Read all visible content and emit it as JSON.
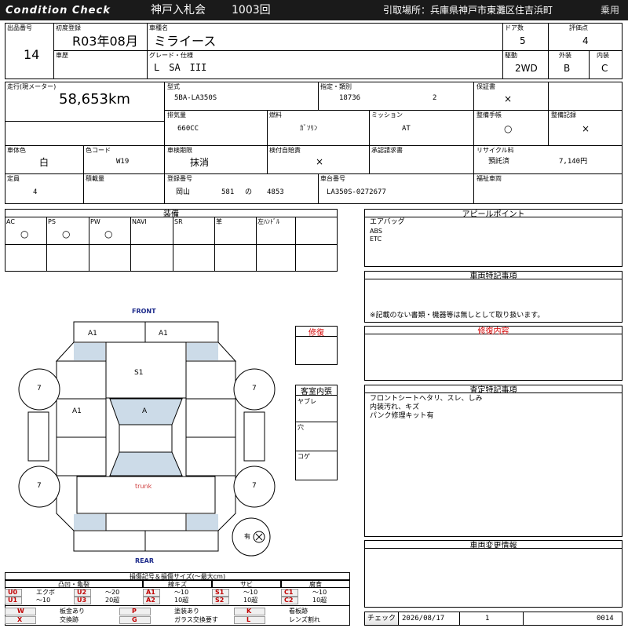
{
  "header": {
    "brand": "Condition Check",
    "auction": "神戸入札会",
    "session": "1003回",
    "location": "引取場所：兵庫県神戸市東灘区住吉浜町",
    "category": "乗用"
  },
  "top": {
    "lot_label": "出品番号",
    "lot": "14",
    "first_reg_label": "初度登録",
    "first_reg": "R03年08月",
    "name_label": "車種名",
    "name": "ミライース",
    "doors_label": "ドア数",
    "doors": "5",
    "score_label": "評価点",
    "score": "4",
    "history_label": "車歴",
    "grade_label": "グレード・仕様",
    "grade": "L　SA　III",
    "drive_label": "駆動",
    "drive": "2WD",
    "ext_label": "外装",
    "ext": "B",
    "int_label": "内装",
    "int": "C"
  },
  "spec": {
    "mileage_label": "走行(現メーター)",
    "mileage": "58,653km",
    "model_label": "型式",
    "model": "5BA-LA350S",
    "cat_label": "指定・類別",
    "cat_a": "18736",
    "cat_b": "2",
    "warranty_label": "保証書",
    "warranty": "×",
    "disp_label": "排気量",
    "disp": "660CC",
    "fuel_label": "燃料",
    "fuel": "ｶﾞｿﾘﾝ",
    "mission_label": "ミッション",
    "mission": "AT",
    "manual_label": "整備手帳",
    "manual": "○",
    "record_label": "整備記録",
    "record": "×",
    "color_label": "車体色",
    "color": "白",
    "color_code_label": "色コード",
    "color_code": "W19",
    "inspect_label": "車検期限",
    "inspect": "抹消",
    "insurance_label": "検付自賠責",
    "insurance": "×",
    "approve_label": "承認請求書",
    "recycle_label": "リサイクル料",
    "recycle_status": "預託済",
    "recycle_fee": "7,140円",
    "capacity_label": "定員",
    "capacity": "4",
    "load_label": "積載量",
    "reg_label": "登録番号",
    "reg_area": "岡山",
    "reg_class": "581",
    "reg_kana": "の",
    "reg_no": "4853",
    "chassis_label": "車台番号",
    "chassis": "LA350S-0272677",
    "welfare_label": "福祉車両"
  },
  "equipment": {
    "title": "装備",
    "items": [
      {
        "label": "AC",
        "mark": "○"
      },
      {
        "label": "PS",
        "mark": "○"
      },
      {
        "label": "PW",
        "mark": "○"
      },
      {
        "label": "NAVI",
        "mark": ""
      },
      {
        "label": "SR",
        "mark": ""
      },
      {
        "label": "革",
        "mark": ""
      },
      {
        "label": "左ﾊﾝﾄﾞﾙ",
        "mark": ""
      }
    ]
  },
  "appeal": {
    "title": "アピールポイント",
    "lines": [
      "エアバッグ",
      "ABS",
      "ETC"
    ]
  },
  "special": {
    "title": "車両特記事項",
    "note": "※記載のない書類・機器等は無しとして取り扱います。"
  },
  "repair_content": {
    "title": "修復内容"
  },
  "assess": {
    "title": "査定特記事項",
    "lines": [
      "フロントシートヘタリ、スレ、しみ",
      "内装汚れ、キズ",
      "パンク修理キット有"
    ]
  },
  "change": {
    "title": "車両変更情報"
  },
  "diagram": {
    "front": "FRONT",
    "rear": "REAR",
    "trunk": "trunk",
    "marks": {
      "fl": "A1",
      "fr": "A1",
      "roof": "S1",
      "left_door": "A1",
      "windshield": "A"
    },
    "tires": {
      "fl": "7",
      "fr": "7",
      "rl": "7",
      "rr": "7"
    },
    "pedal_label": "有",
    "repair_label": "修復"
  },
  "cabin": {
    "title": "客室内張",
    "items": [
      "ヤブレ",
      "穴",
      "コゲ"
    ]
  },
  "legend": {
    "title": "損傷記号＆損傷サイズ(～最大cm)",
    "groups": [
      "凸凹・亀裂",
      "線キズ",
      "サビ",
      "腐食"
    ],
    "rows": [
      [
        {
          "c": "U0",
          "t": "エクボ"
        },
        {
          "c": "U2",
          "t": "～20"
        },
        {
          "c": "A1",
          "t": "～10"
        },
        {
          "c": "S1",
          "t": "～10"
        },
        {
          "c": "C1",
          "t": "～10"
        }
      ],
      [
        {
          "c": "U1",
          "t": "～10"
        },
        {
          "c": "U3",
          "t": "20超"
        },
        {
          "c": "A2",
          "t": "10超"
        },
        {
          "c": "S2",
          "t": "10超"
        },
        {
          "c": "C2",
          "t": "10超"
        }
      ]
    ],
    "rows2": [
      [
        {
          "c": "W",
          "t": "板金あり"
        },
        {
          "c": "P",
          "t": "塗装あり"
        },
        {
          "c": "K",
          "t": "看板跡"
        }
      ],
      [
        {
          "c": "X",
          "t": "交換跡"
        },
        {
          "c": "G",
          "t": "ガラス交換要す"
        },
        {
          "c": "L",
          "t": "レンズ割れ"
        }
      ]
    ]
  },
  "footer": {
    "check_label": "チェック",
    "date": "2026/08/17",
    "num": "1",
    "code": "0014"
  },
  "colors": {
    "header_bg": "#1a1a1a",
    "blue_panel": "#ccdbe8",
    "red_text": "#d40000",
    "code_red": "#c00000"
  }
}
